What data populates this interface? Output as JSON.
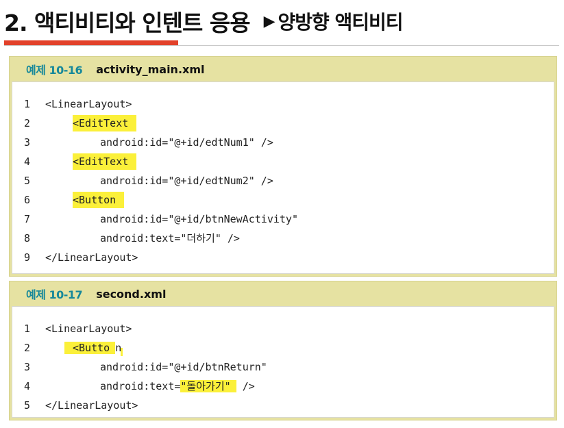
{
  "title": {
    "main": "2. 액티비티와 인텐트 응용",
    "arrow": "▶",
    "sub": "양방향 액티비티"
  },
  "colors": {
    "accent_red": "#e2412a",
    "panel_bg": "#e6e2a2",
    "label_teal": "#16889a",
    "highlight_yellow": "#fbf03a"
  },
  "example1": {
    "label": "예제 10-16",
    "file": "activity_main.xml",
    "lines": [
      {
        "num": "1",
        "code": "<LinearLayout>"
      },
      {
        "num": "2",
        "code": "<EditText"
      },
      {
        "num": "3",
        "code": "android:id=\"@+id/edtNum1\" />"
      },
      {
        "num": "4",
        "code": "<EditText"
      },
      {
        "num": "5",
        "code": "android:id=\"@+id/edtNum2\" />"
      },
      {
        "num": "6",
        "code": "<Button"
      },
      {
        "num": "7",
        "code": "android:id=\"@+id/btnNewActivity\""
      },
      {
        "num": "8",
        "code": "android:text=\"더하기\" />"
      },
      {
        "num": "9",
        "code": "</LinearLayout>"
      }
    ]
  },
  "example2": {
    "label": "예제 10-17",
    "file": "second.xml",
    "lines": [
      {
        "num": "1",
        "code": "<LinearLayout>"
      },
      {
        "num": "2",
        "code_a": "<Butto",
        "code_b": "n"
      },
      {
        "num": "3",
        "code": "android:id=\"@+id/btnReturn\""
      },
      {
        "num": "4",
        "code_a": "android:text=",
        "code_b": "\"돌아가기\"",
        "code_c": " />"
      },
      {
        "num": "5",
        "code": "</LinearLayout>"
      }
    ]
  }
}
